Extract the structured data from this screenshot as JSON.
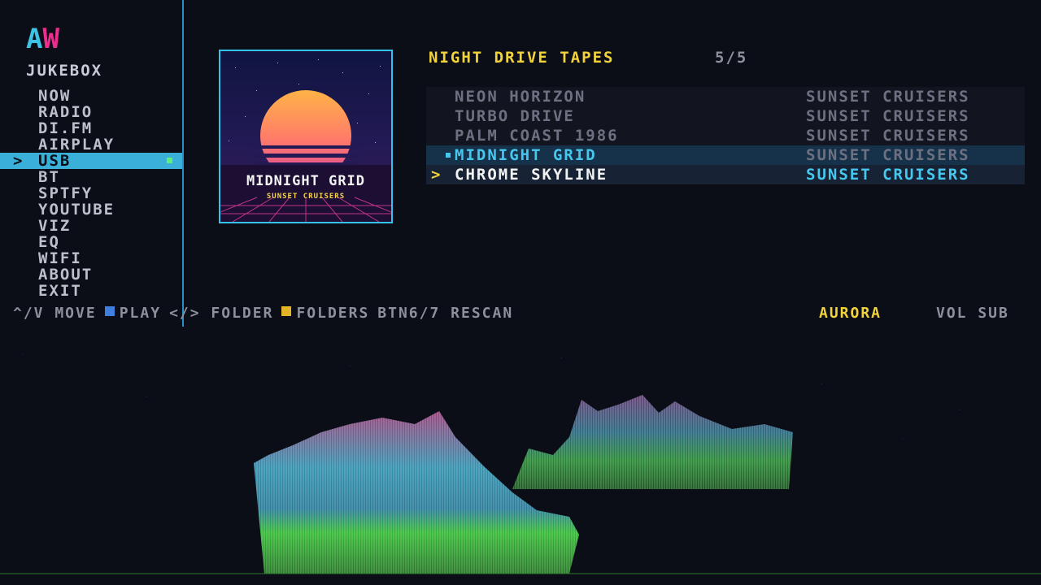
{
  "logo": {
    "a": "A",
    "w": "W"
  },
  "app_title": "JUKEBOX",
  "menu": [
    {
      "label": "NOW"
    },
    {
      "label": "RADIO"
    },
    {
      "label": "DI.FM"
    },
    {
      "label": "AIRPLAY"
    },
    {
      "label": "USB",
      "active": true
    },
    {
      "label": "BT"
    },
    {
      "label": "SPTFY"
    },
    {
      "label": "YOUTUBE"
    },
    {
      "label": "VIZ"
    },
    {
      "label": "EQ"
    },
    {
      "label": "WIFI"
    },
    {
      "label": "ABOUT"
    },
    {
      "label": "EXIT"
    }
  ],
  "menu_cursor": ">",
  "album": {
    "title": "MIDNIGHT GRID",
    "artist": "SUNSET CRUISERS"
  },
  "playlist": {
    "title": "NIGHT DRIVE TAPES",
    "count": "5/5",
    "cursor": ">",
    "tracks": [
      {
        "title": "NEON HORIZON",
        "artist": "SUNSET CRUISERS"
      },
      {
        "title": "TURBO DRIVE",
        "artist": "SUNSET CRUISERS"
      },
      {
        "title": "PALM COAST 1986",
        "artist": "SUNSET CRUISERS"
      },
      {
        "title": "MIDNIGHT GRID",
        "artist": "SUNSET CRUISERS",
        "state": "playing"
      },
      {
        "title": "CHROME SKYLINE",
        "artist": "SUNSET CRUISERS",
        "state": "selected"
      }
    ]
  },
  "footer": {
    "move": "^/V MOVE",
    "play": "PLAY",
    "folder": "</> FOLDER",
    "folders": "FOLDERS",
    "rescan": "BTN6/7 RESCAN",
    "viz_name": "AURORA",
    "vol_sub": "VOL SUB"
  },
  "colors": {
    "accent_cyan": "#3ab0d8",
    "accent_yellow": "#f3d33a",
    "logo_pink": "#ee2c8e",
    "playing_indicator": "#5cf07a"
  }
}
